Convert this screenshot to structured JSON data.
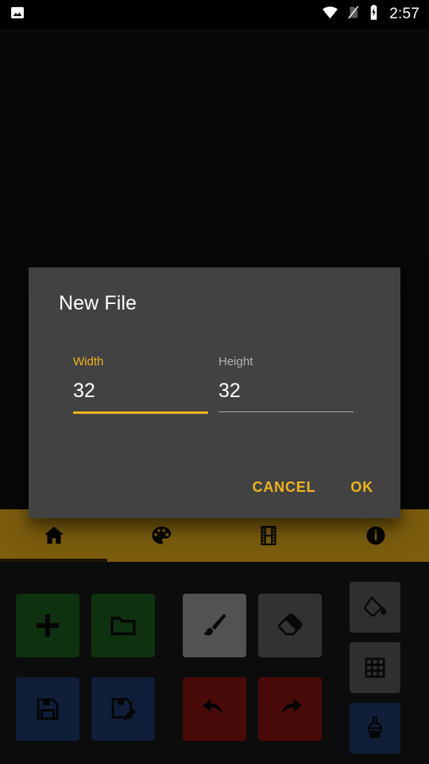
{
  "status_bar": {
    "notification_icon": "image-icon",
    "wifi_icon": "wifi-icon",
    "sim_icon": "no-sim-icon",
    "battery_icon": "battery-charging-icon",
    "time": "2:57"
  },
  "tab_bar": {
    "background_color": "#f0b41e",
    "active_index": 0,
    "tabs": [
      {
        "name": "home",
        "icon": "home-icon"
      },
      {
        "name": "palette",
        "icon": "palette-icon"
      },
      {
        "name": "frames",
        "icon": "film-strip-icon"
      },
      {
        "name": "info",
        "icon": "info-icon"
      }
    ]
  },
  "toolbar": {
    "buttons": [
      {
        "name": "new-file",
        "icon": "plus-icon",
        "color": "#1b5e20"
      },
      {
        "name": "open-file",
        "icon": "folder-icon",
        "color": "#1b5e20"
      },
      {
        "name": "brush-tool",
        "icon": "paintbrush-icon",
        "color": "#9e9e9e",
        "selected": true
      },
      {
        "name": "eraser-tool",
        "icon": "eraser-icon",
        "color": "#616161"
      },
      {
        "name": "save",
        "icon": "floppy-icon",
        "color": "#1f3b6e"
      },
      {
        "name": "save-as",
        "icon": "floppy-edit-icon",
        "color": "#1f3b6e"
      },
      {
        "name": "undo",
        "icon": "undo-arrow-icon",
        "color": "#8d1414"
      },
      {
        "name": "redo",
        "icon": "redo-arrow-icon",
        "color": "#8d1414"
      },
      {
        "name": "fill-tool",
        "icon": "paint-bucket-icon",
        "color": "#5b5b5b"
      },
      {
        "name": "grid-toggle",
        "icon": "grid-icon",
        "color": "#5b5b5b"
      },
      {
        "name": "wide-brush",
        "icon": "wide-brush-icon",
        "color": "#1f3b6e"
      }
    ]
  },
  "dialog": {
    "title": "New File",
    "accent_color": "#f0b41e",
    "background_color": "#424242",
    "fields": [
      {
        "name": "width",
        "label": "Width",
        "value": "32",
        "focused": true
      },
      {
        "name": "height",
        "label": "Height",
        "value": "32",
        "focused": false
      }
    ],
    "cancel_label": "CANCEL",
    "ok_label": "OK"
  }
}
